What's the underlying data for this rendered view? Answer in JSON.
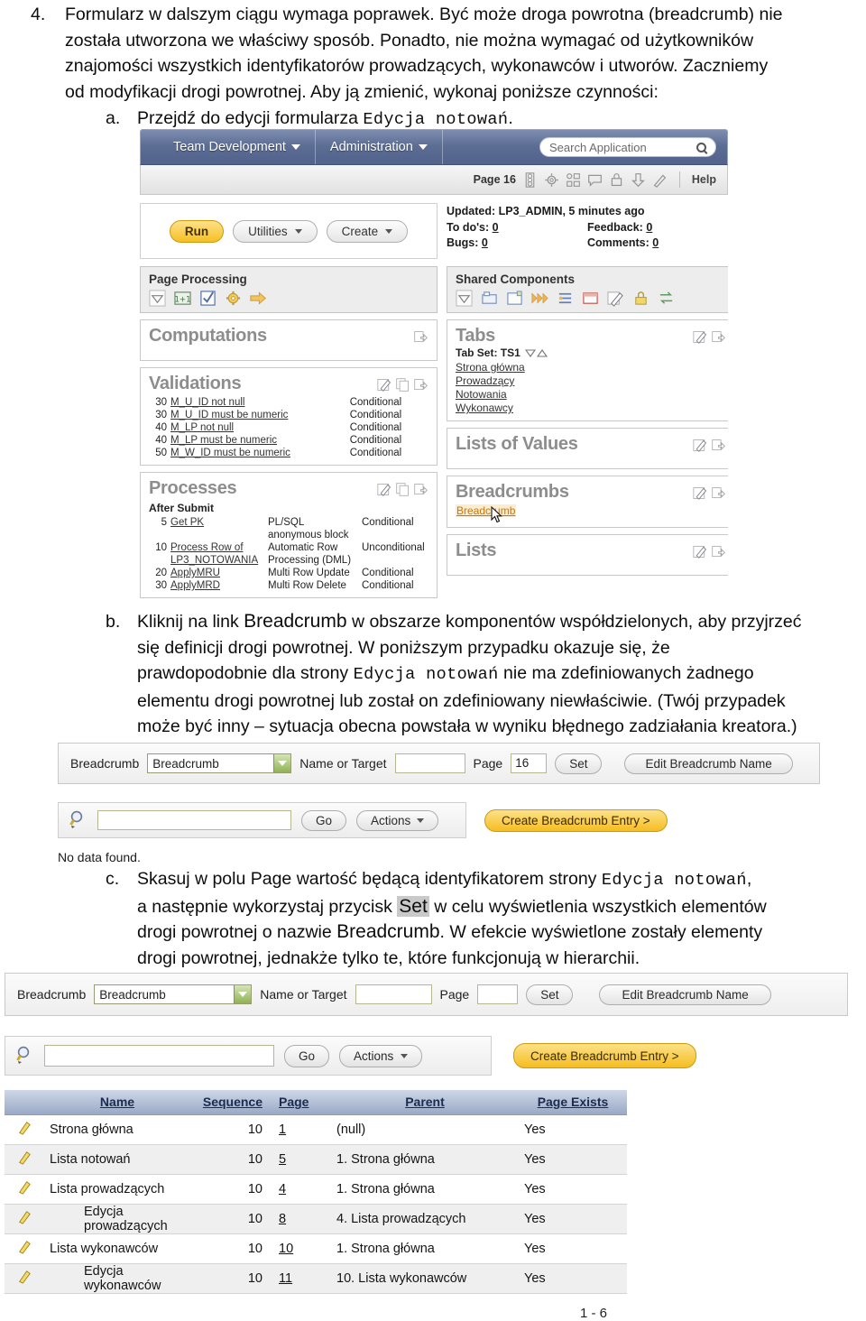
{
  "document": {
    "item_number": "4.",
    "paragraph_4": {
      "line1": "Formularz w dalszym ciągu wymaga poprawek. Być może droga powrotna (breadcrumb) nie",
      "line2": "została utworzona we właściwy sposób. Ponadto, nie można wymagać od użytkowników",
      "line3": "znajomości wszystkich identyfikatorów prowadzących, wykonawców i utworów. Zaczniemy",
      "line4": "od modyfikacji drogi powrotnej. Aby ją zmienić, wykonaj poniższe czynności:"
    },
    "item_a": {
      "marker": "a.",
      "text_before": "Przejdź do edycji formularza ",
      "code": "Edycja notowań",
      "text_after": "."
    },
    "item_b": {
      "marker": "b.",
      "l1a": "Kliknij na link ",
      "l1b": "Breadcrumb",
      "l1c": " w obszarze komponentów współdzielonych, aby przyjrzeć",
      "l2": "się definicji drogi powrotnej. W poniższym przypadku okazuje się, że",
      "l3a": "prawdopodobnie dla strony ",
      "l3b": "Edycja notowań",
      "l3c": " nie ma zdefiniowanych żadnego",
      "l4": "elementu drogi powrotnej lub został on zdefiniowany niewłaściwie. (Twój przypadek",
      "l5": "może być inny – sytuacja obecna powstała w wyniku błędnego zadziałania kreatora.)"
    },
    "item_c": {
      "marker": "c.",
      "l1a": "Skasuj w polu Page wartość będącą identyfikatorem strony ",
      "l1b": "Edycja notowań",
      "l1c": ",",
      "l2a": "a następnie wykorzystaj przycisk ",
      "l2b": "Set",
      "l2c": " w celu wyświetlenia wszystkich elementów",
      "l3a": "drogi powrotnej o nazwie ",
      "l3b": "Breadcrumb",
      "l3c": ". W efekcie wyświetlone zostały elementy",
      "l4": "drogi powrotnej, jednakże tylko te, które funkcjonują w hierarchii."
    }
  },
  "apex_builder": {
    "menubar": {
      "team_development": "Team Development",
      "administration": "Administration",
      "search_placeholder": "Search Application",
      "search_icon": "magnifier-icon"
    },
    "toolbar": {
      "page_label": "Page 16",
      "icons": [
        "page-list-icon",
        "gear-icon",
        "layout-icon",
        "comment-icon",
        "lock-icon",
        "download-icon",
        "run-icon"
      ],
      "help": "Help"
    },
    "actions": {
      "run": "Run",
      "utilities": "Utilities",
      "create": "Create"
    },
    "stats": {
      "updated": "Updated: LP3_ADMIN, 5 minutes ago",
      "todos_label": "To do's:",
      "todos_value": "0",
      "feedback_label": "Feedback:",
      "feedback_value": "0",
      "bugs_label": "Bugs:",
      "bugs_value": "0",
      "comments_label": "Comments:",
      "comments_value": "0"
    },
    "page_processing": {
      "title": "Page Processing",
      "icons": [
        "triangle-down-icon",
        "computation-icon",
        "validation-icon",
        "process-gear-icon",
        "branch-arrow-icon"
      ]
    },
    "computations": {
      "title": "Computations"
    },
    "validations": {
      "title": "Validations",
      "rows": [
        {
          "seq": "30",
          "name": "M_U_ID not null",
          "cond": "Conditional"
        },
        {
          "seq": "30",
          "name": "M_U_ID must be numeric",
          "cond": "Conditional"
        },
        {
          "seq": "40",
          "name": "M_LP not null",
          "cond": "Conditional"
        },
        {
          "seq": "40",
          "name": "M_LP must be numeric",
          "cond": "Conditional"
        },
        {
          "seq": "50",
          "name": "M_W_ID must be numeric",
          "cond": "Conditional"
        }
      ]
    },
    "processes": {
      "title": "Processes",
      "subhead": "After Submit",
      "rows": [
        {
          "seq": "5",
          "name": "Get PK",
          "type": "PL/SQL anonymous block",
          "cond": "Conditional"
        },
        {
          "seq": "10",
          "name": "Process Row of LP3_NOTOWANIA",
          "type": "Automatic Row Processing (DML)",
          "cond": "Unconditional"
        },
        {
          "seq": "20",
          "name": "ApplyMRU",
          "type": "Multi Row Update",
          "cond": "Conditional"
        },
        {
          "seq": "30",
          "name": "ApplyMRD",
          "type": "Multi Row Delete",
          "cond": "Conditional"
        }
      ]
    },
    "shared_components": {
      "title": "Shared Components",
      "icons": [
        "triangle-down-icon",
        "tabs-icon",
        "template-icon",
        "navigation-icon",
        "list-icon",
        "region-icon",
        "edit-icon",
        "lock-icon",
        "shortcut-icon"
      ]
    },
    "tabs": {
      "title": "Tabs",
      "tabset_label": "Tab Set: TS1",
      "items": [
        "Strona główna",
        "Prowadzący",
        "Notowania",
        "Wykonawcy"
      ]
    },
    "lists_of_values": {
      "title": "Lists of Values"
    },
    "breadcrumbs": {
      "title": "Breadcrumbs",
      "item": "Breadcrumb"
    },
    "lists": {
      "title": "Lists"
    }
  },
  "breadcrumb_editor_before": {
    "bc_label": "Breadcrumb",
    "bc_select_value": "Breadcrumb",
    "name_or_target_label": "Name or Target",
    "name_or_target_value": "",
    "page_label": "Page",
    "page_value": "16",
    "set_button": "Set",
    "edit_name_button": "Edit Breadcrumb Name",
    "search_icon": "magnifier-icon",
    "search_value": "",
    "go_button": "Go",
    "actions_button": "Actions",
    "create_entry_button": "Create Breadcrumb Entry >",
    "no_data": "No data found."
  },
  "breadcrumb_editor_after": {
    "bc_label": "Breadcrumb",
    "bc_select_value": "Breadcrumb",
    "name_or_target_label": "Name or Target",
    "name_or_target_value": "",
    "page_label": "Page",
    "page_value": "",
    "set_button": "Set",
    "edit_name_button": "Edit Breadcrumb Name",
    "search_icon": "magnifier-icon",
    "search_value": "",
    "go_button": "Go",
    "actions_button": "Actions",
    "create_entry_button": "Create Breadcrumb Entry >"
  },
  "breadcrumb_report": {
    "columns": [
      "Name",
      "Sequence",
      "Page",
      "Parent",
      "Page Exists"
    ],
    "rows": [
      {
        "indent": 0,
        "name": "Strona główna",
        "sequence": "10",
        "page": "1",
        "parent": "(null)",
        "exists": "Yes"
      },
      {
        "indent": 1,
        "name": "Lista notowań",
        "sequence": "10",
        "page": "5",
        "parent": "1. Strona główna",
        "exists": "Yes"
      },
      {
        "indent": 1,
        "name": "Lista prowadzących",
        "sequence": "10",
        "page": "4",
        "parent": "1. Strona główna",
        "exists": "Yes"
      },
      {
        "indent": 2,
        "name": "Edycja prowadzących",
        "sequence": "10",
        "page": "8",
        "parent": "4. Lista prowadzących",
        "exists": "Yes"
      },
      {
        "indent": 1,
        "name": "Lista wykonawców",
        "sequence": "10",
        "page": "10",
        "parent": "1. Strona główna",
        "exists": "Yes"
      },
      {
        "indent": 2,
        "name": "Edycja wykonawców",
        "sequence": "10",
        "page": "11",
        "parent": "10. Lista wykonawców",
        "exists": "Yes"
      }
    ],
    "pagination": "1 - 6",
    "row_edit_icon": "pencil-icon"
  },
  "colors": {
    "menubar_blue": "#5d6e95",
    "accent_gold": "#f6c024",
    "table_header_blue": "#9aa9c6",
    "link_orange": "#c07a14",
    "panel_title_grey": "#8d8d8d"
  }
}
